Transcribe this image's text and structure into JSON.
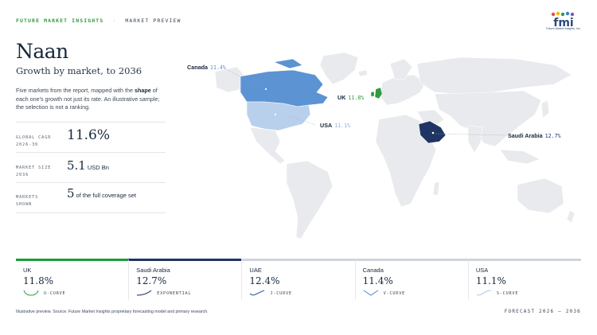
{
  "header": {
    "brand": "FUTURE MARKET INSIGHTS",
    "separator": "·",
    "section": "MARKET PREVIEW",
    "logo_text": "fmi",
    "logo_tagline": "Future Market Insights, Inc."
  },
  "title": "Naan",
  "subtitle": "Growth by market, to 2036",
  "description": {
    "before": "Five markets from the report, mapped with the ",
    "bold": "shape",
    "after": " of each one's growth not just its rate. An illustrative sample; the selection is not a ranking."
  },
  "stats": [
    {
      "label_line1": "GLOBAL CAGR",
      "label_line2": "2026-36",
      "value": "11.6%",
      "unit": ""
    },
    {
      "label_line1": "MARKET SIZE",
      "label_line2": "2036",
      "value": "5.1",
      "unit": "USD Bn"
    },
    {
      "label_line1": "MARKETS",
      "label_line2": "SHOWN",
      "value": "5",
      "unit": "of the full coverage set"
    }
  ],
  "map_labels": {
    "canada": {
      "name": "Canada",
      "pct": "11.4%"
    },
    "uk": {
      "name": "UK",
      "pct": "11.8%"
    },
    "usa": {
      "name": "USA",
      "pct": "11.1%"
    },
    "saudi": {
      "name": "Saudi Arabia",
      "pct": "12.7%"
    }
  },
  "markets": [
    {
      "name": "UK",
      "value": "11.8%",
      "shape": "U-CURVE",
      "color": "#1f9a3a",
      "bar_color": "#1f9a3a"
    },
    {
      "name": "Saudi Arabia",
      "value": "12.7%",
      "shape": "EXPONENTIAL",
      "color": "#1f3563",
      "bar_color": "#1f3563"
    },
    {
      "name": "UAE",
      "value": "12.4%",
      "shape": "J-CURVE",
      "color": "#2b5faa",
      "bar_color": "#cfd5dc"
    },
    {
      "name": "Canada",
      "value": "11.4%",
      "shape": "V-CURVE",
      "color": "#4a86c8",
      "bar_color": "#cfd5dc"
    },
    {
      "name": "USA",
      "value": "11.1%",
      "shape": "S-CURVE",
      "color": "#a9c5e6",
      "bar_color": "#cfd5dc"
    }
  ],
  "footer": {
    "note": "Illustrative preview. Source: Future Market Insights proprietary forecasting model and primary research.",
    "range": "FORECAST 2026 – 2036"
  },
  "colors": {
    "land": "#e8eaed",
    "canada": "#5b93d3",
    "usa": "#b9d0ec",
    "uk": "#2f9a3e",
    "saudi": "#1f3563"
  }
}
